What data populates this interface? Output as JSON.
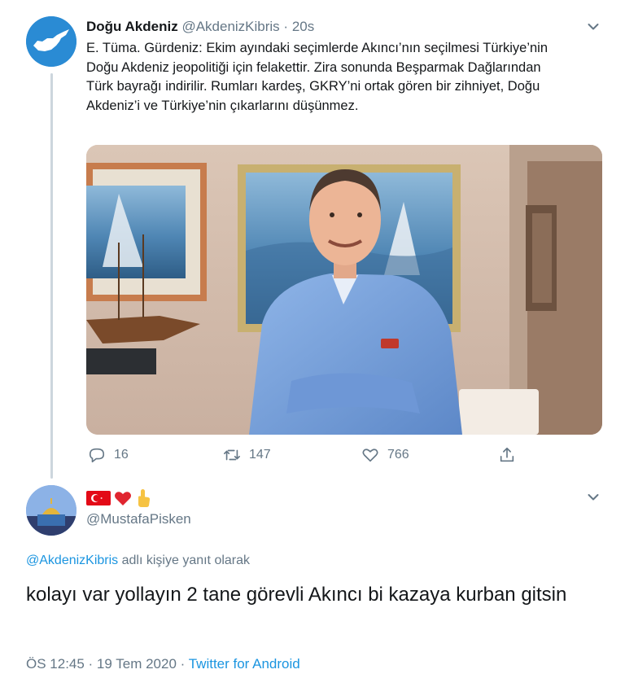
{
  "parent_tweet": {
    "display_name": "Doğu Akdeniz",
    "handle": "@AkdenizKibris",
    "separator": "·",
    "time": "20s",
    "text": "E. Tüma. Gürdeniz: Ekim ayındaki seçimlerde Akıncı’nın seçilmesi Türkiye’nin Doğu Akdeniz jeopolitiği için felakettir. Zira sonunda Beşparmak Dağlarından Türk bayrağı indirilir. Rumları kardeş, GKRY’ni ortak gören bir zihniyet, Doğu Akdeniz’i ve Türkiye’nin çıkarlarını düşünmez.",
    "counts": {
      "replies": "16",
      "retweets": "147",
      "likes": "766"
    }
  },
  "reply_tweet": {
    "handle": "@MustafaPisken",
    "reply_prefix_mention": "@AkdenizKibris",
    "reply_prefix_text": " adlı kişiye yanıt olarak",
    "text": "kolayı var yollayın 2 tane  görevli Akıncı bi kazaya kurban gitsin",
    "timestamp": "ÖS 12:45 · 19 Tem 2020 · ",
    "source": "Twitter for Android",
    "emoji_icons": [
      "turkish-flag-icon",
      "red-heart-icon",
      "pointing-up-hand-icon"
    ]
  },
  "colors": {
    "accent": "#1b95e0",
    "secondary_text": "#657786",
    "thread_line": "#ccd6dd",
    "avatar_parent": "#2a8bd4"
  }
}
